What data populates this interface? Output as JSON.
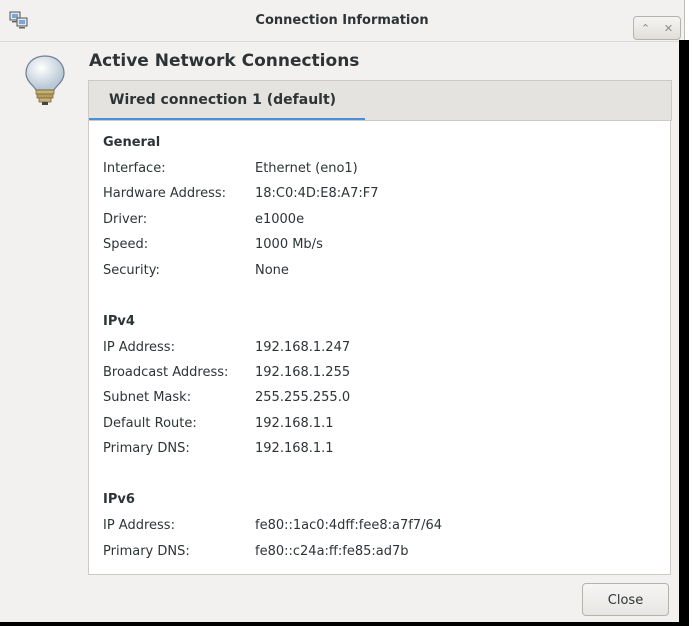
{
  "window": {
    "title": "Connection Information",
    "buttons": {
      "maximize_icon": "⌃",
      "close_icon": "✕"
    }
  },
  "heading": "Active Network Connections",
  "tab": {
    "label": "Wired connection 1 (default)",
    "accent": "#4a90d9"
  },
  "sections": {
    "general": {
      "title": "General",
      "rows": [
        {
          "key": "Interface:",
          "value": "Ethernet (eno1)"
        },
        {
          "key": "Hardware Address:",
          "value": "18:C0:4D:E8:A7:F7"
        },
        {
          "key": "Driver:",
          "value": "e1000e"
        },
        {
          "key": "Speed:",
          "value": "1000 Mb/s"
        },
        {
          "key": "Security:",
          "value": "None"
        }
      ]
    },
    "ipv4": {
      "title": "IPv4",
      "rows": [
        {
          "key": "IP Address:",
          "value": "192.168.1.247"
        },
        {
          "key": "Broadcast Address:",
          "value": "192.168.1.255"
        },
        {
          "key": "Subnet Mask:",
          "value": "255.255.255.0"
        },
        {
          "key": "Default Route:",
          "value": "192.168.1.1"
        },
        {
          "key": "Primary DNS:",
          "value": "192.168.1.1"
        }
      ]
    },
    "ipv6": {
      "title": "IPv6",
      "rows": [
        {
          "key": "IP Address:",
          "value": "fe80::1ac0:4dff:fee8:a7f7/64"
        },
        {
          "key": "Primary DNS:",
          "value": "fe80::c24a:ff:fe85:ad7b"
        }
      ]
    }
  },
  "footer": {
    "close_label": "Close"
  }
}
